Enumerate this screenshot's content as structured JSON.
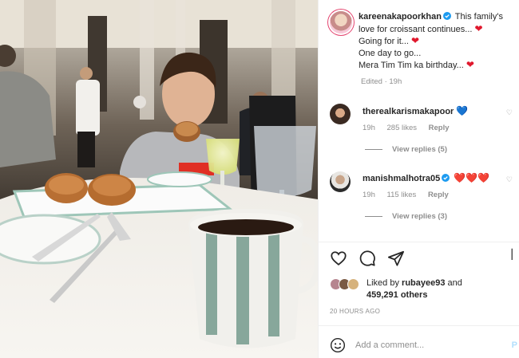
{
  "caption": {
    "username": "kareenakapoorkhan",
    "text_line1": "This family's",
    "text_line2": "love for croissant continues...",
    "text_line3": "Going for it...",
    "text_line4": "One day to go...",
    "text_line5": "Mera Tim Tim ka birthday...",
    "edited_time": "Edited · 19h"
  },
  "comments": [
    {
      "username": "therealkarismakapoor",
      "emoji": "💙",
      "time": "19h",
      "likes": "285 likes",
      "reply_label": "Reply",
      "view_replies": "View replies (5)"
    },
    {
      "username": "manishmalhotra05",
      "emoji": "❤️❤️❤️",
      "time": "19h",
      "likes": "115 likes",
      "reply_label": "Reply",
      "view_replies": "View replies (3)"
    }
  ],
  "liked_by": {
    "prefix": "Liked by",
    "user": "rubayee93",
    "conj": "and",
    "others": "459,291 others"
  },
  "post_age": "20 HOURS AGO",
  "add_comment": {
    "placeholder": "Add a comment...",
    "post_label": "P"
  },
  "icons": {
    "like": "heart-outline-icon",
    "comment": "comment-bubble-icon",
    "share": "paper-plane-icon",
    "emoji": "smiley-icon",
    "verified": "verified-badge-icon"
  },
  "colors": {
    "heart_red": "#e0182d",
    "verified_blue": "#1d9bf0",
    "muted_text": "#8e8e8e",
    "post_button": "#b2dffc"
  }
}
